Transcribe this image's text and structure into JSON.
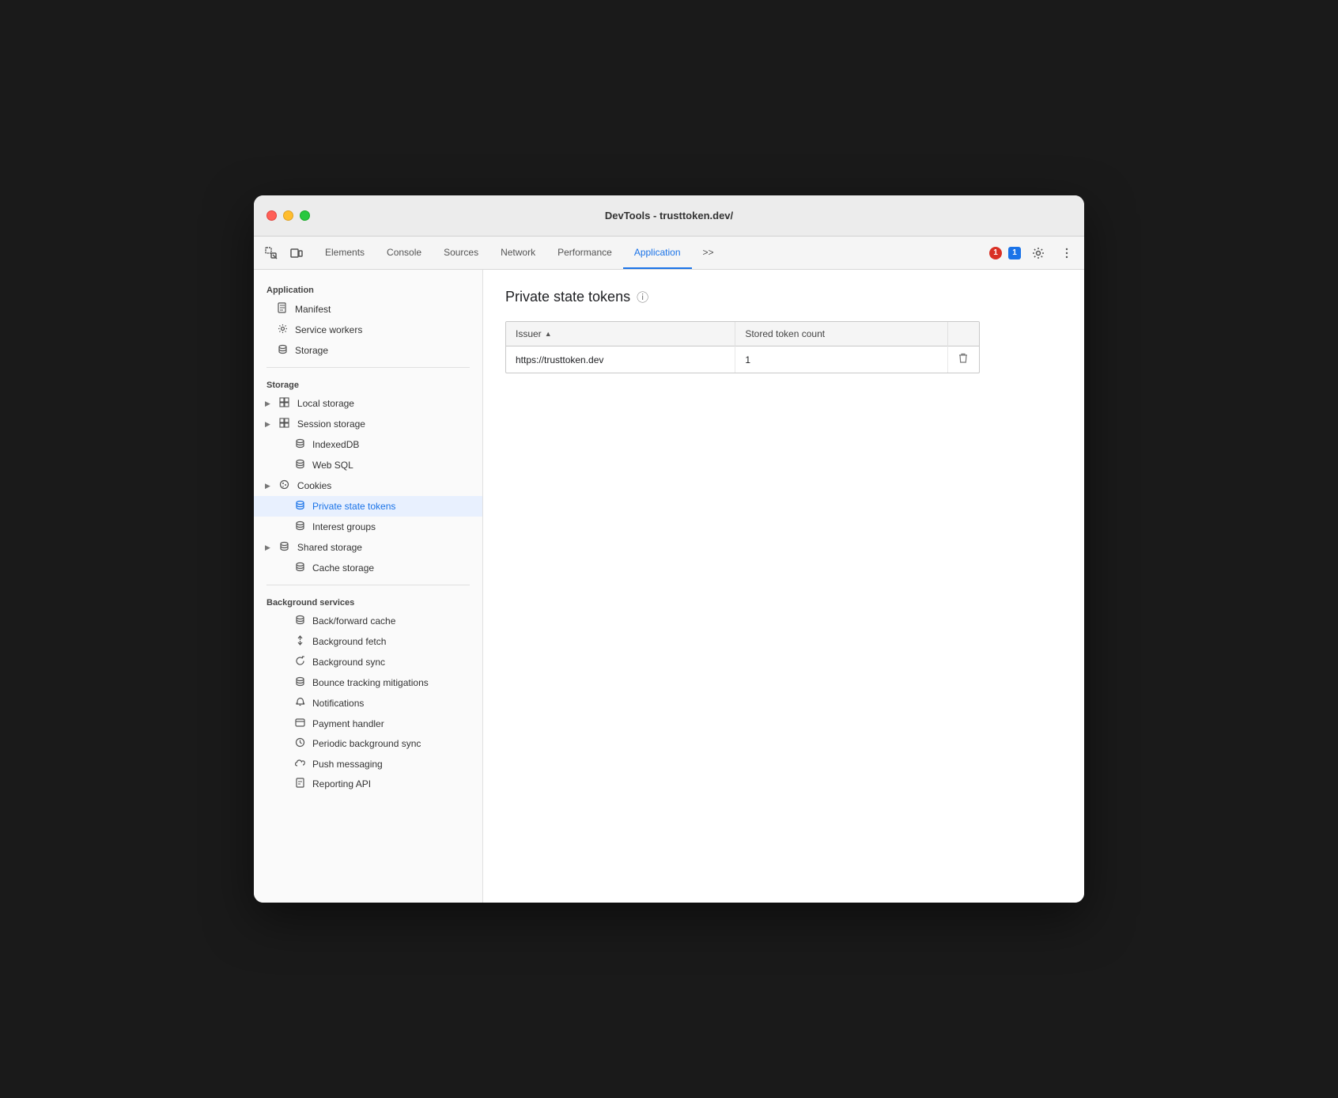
{
  "window": {
    "title": "DevTools - trusttoken.dev/"
  },
  "toolbar": {
    "tabs": [
      {
        "label": "Elements",
        "active": false
      },
      {
        "label": "Console",
        "active": false
      },
      {
        "label": "Sources",
        "active": false
      },
      {
        "label": "Network",
        "active": false
      },
      {
        "label": "Performance",
        "active": false
      },
      {
        "label": "Application",
        "active": true
      }
    ],
    "more_tabs_label": ">>",
    "error_count": "1",
    "info_count": "1"
  },
  "sidebar": {
    "application_section": "Application",
    "application_items": [
      {
        "label": "Manifest",
        "icon": "📄",
        "type": "file"
      },
      {
        "label": "Service workers",
        "icon": "⚙",
        "type": "gear"
      },
      {
        "label": "Storage",
        "icon": "🗄",
        "type": "db"
      }
    ],
    "storage_section": "Storage",
    "storage_items": [
      {
        "label": "Local storage",
        "icon": "▦",
        "arrow": true
      },
      {
        "label": "Session storage",
        "icon": "▦",
        "arrow": true
      },
      {
        "label": "IndexedDB",
        "icon": "🗄",
        "arrow": false
      },
      {
        "label": "Web SQL",
        "icon": "🗄",
        "arrow": false
      },
      {
        "label": "Cookies",
        "icon": "🍪",
        "arrow": true
      },
      {
        "label": "Private state tokens",
        "icon": "🗄",
        "arrow": false,
        "active": true
      },
      {
        "label": "Interest groups",
        "icon": "🗄",
        "arrow": false
      },
      {
        "label": "Shared storage",
        "icon": "🗄",
        "arrow": true
      },
      {
        "label": "Cache storage",
        "icon": "🗄",
        "arrow": false
      }
    ],
    "background_section": "Background services",
    "background_items": [
      {
        "label": "Back/forward cache",
        "icon": "🗄"
      },
      {
        "label": "Background fetch",
        "icon": "↑↓"
      },
      {
        "label": "Background sync",
        "icon": "↺"
      },
      {
        "label": "Bounce tracking mitigations",
        "icon": "🗄"
      },
      {
        "label": "Notifications",
        "icon": "🔔"
      },
      {
        "label": "Payment handler",
        "icon": "💳"
      },
      {
        "label": "Periodic background sync",
        "icon": "⏱"
      },
      {
        "label": "Push messaging",
        "icon": "☁"
      },
      {
        "label": "Reporting API",
        "icon": "📄"
      }
    ]
  },
  "main": {
    "page_title": "Private state tokens",
    "table": {
      "columns": [
        {
          "label": "Issuer",
          "sortable": true
        },
        {
          "label": "Stored token count",
          "sortable": false
        },
        {
          "label": "",
          "sortable": false
        }
      ],
      "rows": [
        {
          "issuer": "https://trusttoken.dev",
          "count": "1"
        }
      ]
    }
  }
}
